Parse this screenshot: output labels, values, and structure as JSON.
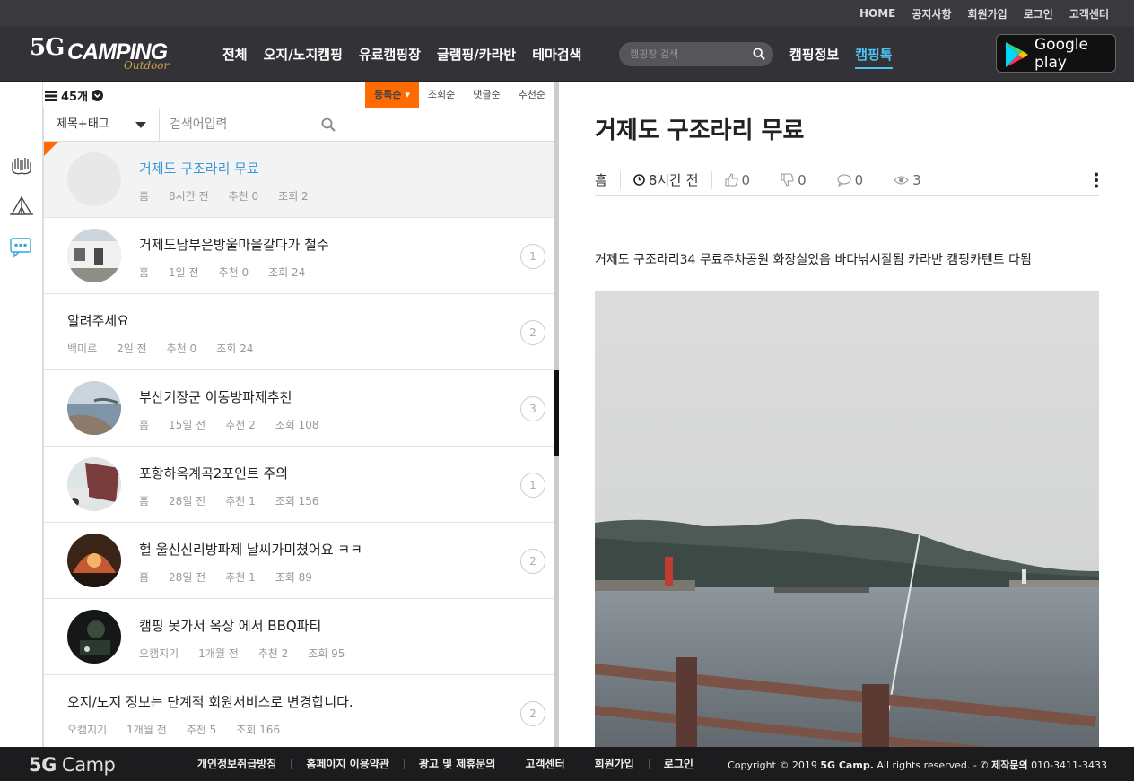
{
  "topbar": {
    "links": [
      "HOME",
      "공지사항",
      "회원가입",
      "로그인",
      "고객센터"
    ]
  },
  "logo": {
    "prefix": "5G",
    "name": "CAMPING",
    "sub": "Outdoor"
  },
  "mainnav": [
    "전체",
    "오지/노지캠핑",
    "유료캠핑장",
    "글램핑/카라반",
    "테마검색"
  ],
  "search": {
    "placeholder": "캠핑장 검색"
  },
  "rightnav": {
    "info": "캠핑정보",
    "talk": "캠핑톡"
  },
  "gplay": {
    "label": "Google play"
  },
  "list": {
    "count": "45개",
    "sort_options": [
      "등록순",
      "조회순",
      "댓글순",
      "추천순"
    ],
    "filter_select": "제목+태그",
    "search_placeholder": "검색어입력",
    "rows": [
      {
        "title": "거제도 구조라리 무료",
        "author": "흠",
        "time": "8시간 전",
        "likes": "추천 0",
        "views": "조회 2",
        "comments": "",
        "thumb": "none",
        "selected": true,
        "new": true
      },
      {
        "title": "거제도남부은방울마을같다가 철수",
        "author": "흠",
        "time": "1일 전",
        "likes": "추천 0",
        "views": "조회 24",
        "comments": "1",
        "thumb": "building"
      },
      {
        "title": "알려주세요",
        "author": "백미르",
        "time": "2일 전",
        "likes": "추천 0",
        "views": "조회 24",
        "comments": "2",
        "thumb": ""
      },
      {
        "title": "부산기장군 이동방파제추천",
        "author": "흠",
        "time": "15일 전",
        "likes": "추천 2",
        "views": "조회 108",
        "comments": "3",
        "thumb": "sea"
      },
      {
        "title": "포항하옥계곡2포인트 주의",
        "author": "흠",
        "time": "28일 전",
        "likes": "추천 1",
        "views": "조회 156",
        "comments": "1",
        "thumb": "tent"
      },
      {
        "title": "헐 울신신리방파제 날씨가미쳤어요 ㅋㅋ",
        "author": "흠",
        "time": "28일 전",
        "likes": "추천 1",
        "views": "조회 89",
        "comments": "2",
        "thumb": "night"
      },
      {
        "title": "캠핑 못가서 옥상 에서 BBQ파티",
        "author": "오캠지기",
        "time": "1개월 전",
        "likes": "추천 2",
        "views": "조회 95",
        "comments": "",
        "thumb": "dark"
      },
      {
        "title": "오지/노지 정보는 단계적 회원서비스로 변경합니다.",
        "author": "오캠지기",
        "time": "1개월 전",
        "likes": "추천 5",
        "views": "조회 166",
        "comments": "2",
        "thumb": ""
      }
    ]
  },
  "detail": {
    "title": "거제도 구조라리 무료",
    "author": "흠",
    "time": "8시간 전",
    "likes": "0",
    "dislikes": "0",
    "comments": "0",
    "views": "3",
    "body": "거제도 구조라리34 무료주차공원 화장실있음 바다낚시잘됨 카라반 캠핑카텐트 다됨"
  },
  "footer": {
    "logo_bold": "5G",
    "logo_rest": " Camp",
    "links": [
      "개인정보취급방침",
      "홈페이지 이용약관",
      "광고 및 제휴문의",
      "고객센터",
      "회원가입",
      "로그인"
    ],
    "copyright_pre": "Copyright © 2019 ",
    "copyright_brand": "5G Camp.",
    "copyright_post": " All rights reserved. - ",
    "contact_label": "제작문의",
    "contact_phone": " 010-3411-3433"
  },
  "colors": {
    "accent_orange": "#ff6b00",
    "accent_blue": "#4ec3f5",
    "header_bg": "#333337",
    "link_blue": "#3a98d8"
  }
}
